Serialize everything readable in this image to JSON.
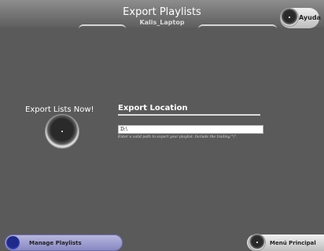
{
  "header": {
    "title": "Export Playlists",
    "subtitle": "Kalis_Laptop",
    "help_label": "Ayuda"
  },
  "export_now": {
    "label": "Export Lists Now!"
  },
  "export_location": {
    "title": "Export Location",
    "path_value": "D:\\",
    "hint": "Enter a valid path to export your playlist. Include the trailing \"\\\"."
  },
  "footer": {
    "manage_label": "Manage Playlists",
    "menu_label": "Menú Principal"
  },
  "colors": {
    "background": "#5a5a5a",
    "header": "#777777",
    "manage_button": "#9a9ad0",
    "knob_blue": "#2a36b0"
  }
}
